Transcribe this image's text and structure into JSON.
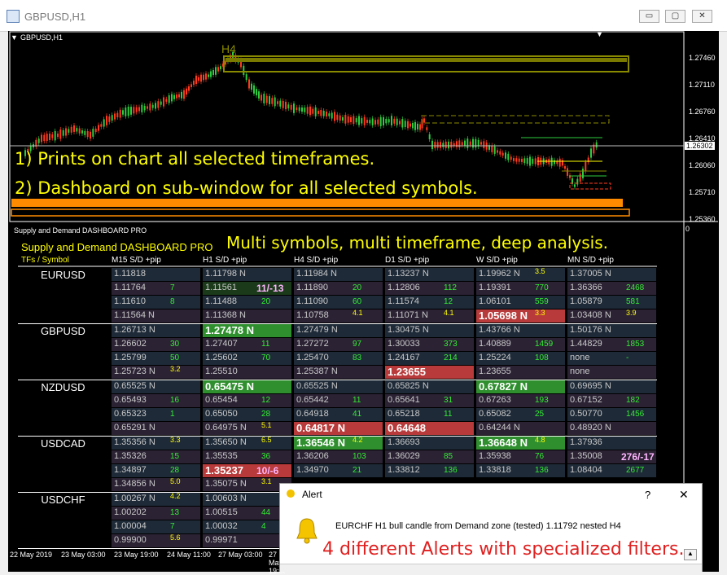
{
  "window": {
    "title": "GBPUSD,H1",
    "min": "▭",
    "max": "▢",
    "close": "✕"
  },
  "chart": {
    "symbol_label": "GBPUSD,H1",
    "tf_marker": "H4",
    "prices": [
      "1.27460",
      "1.27110",
      "1.26760",
      "1.26410",
      "1.26060",
      "1.25710",
      "1.25360"
    ],
    "current_price": "1.26302",
    "line1": "1) Prints on chart all selected timeframes.",
    "line2": "2) Dashboard on sub-window for all selected symbols.",
    "dates": [
      "22 May 2019",
      "23 May 03:00",
      "23 May 19:00",
      "24 May 11:00",
      "27 May 03:00",
      "27 May 19:00"
    ]
  },
  "subwindow": {
    "label": "Supply and Demand DASHBOARD PRO",
    "zero": "0",
    "headline": "Multi symbols, multi timeframe, deep analysis.",
    "dashboard_title": "Supply and Demand DASHBOARD PRO",
    "columns": [
      "TFs / Symbol",
      "M15 S/D +pip",
      "H1 S/D +pip",
      "H4 S/D +pip",
      "D1 S/D +pip",
      "W S/D +pip",
      "MN S/D +pip"
    ]
  },
  "dashboard": [
    {
      "symbol": "EURUSD",
      "rows": [
        [
          [
            "1.11818",
            ""
          ],
          [
            "1.11798 N",
            ""
          ],
          [
            "1.11984 N",
            ""
          ],
          [
            "1.13237 N",
            ""
          ],
          [
            "1.19962 N",
            "3.5"
          ],
          [
            "1.37005 N",
            ""
          ]
        ],
        [
          [
            "1.11764",
            "7"
          ],
          [
            "1.11561",
            "11/-13"
          ],
          [
            "1.11890",
            "20"
          ],
          [
            "1.12806",
            "112"
          ],
          [
            "1.19391",
            "770"
          ],
          [
            "1.36366",
            "2468"
          ]
        ],
        [
          [
            "1.11610",
            "8"
          ],
          [
            "1.11488",
            "20"
          ],
          [
            "1.11090",
            "60"
          ],
          [
            "1.11574",
            "12"
          ],
          [
            "1.06101",
            "559"
          ],
          [
            "1.05879",
            "581"
          ]
        ],
        [
          [
            "1.11564 N",
            ""
          ],
          [
            "1.11368 N",
            ""
          ],
          [
            "1.10758",
            "4.1"
          ],
          [
            "1.11071 N",
            "4.1"
          ],
          [
            "1.05698 N",
            "3.3"
          ],
          [
            "1.03408 N",
            "3.9"
          ]
        ]
      ]
    },
    {
      "symbol": "GBPUSD",
      "rows": [
        [
          [
            "1.26713 N",
            ""
          ],
          [
            "1.27478 N",
            ""
          ],
          [
            "1.27479 N",
            ""
          ],
          [
            "1.30475 N",
            ""
          ],
          [
            "1.43766 N",
            ""
          ],
          [
            "1.50176 N",
            ""
          ]
        ],
        [
          [
            "1.26602",
            "30"
          ],
          [
            "1.27407",
            "11"
          ],
          [
            "1.27272",
            "97"
          ],
          [
            "1.30033",
            "373"
          ],
          [
            "1.40889",
            "1459"
          ],
          [
            "1.44829",
            "1853"
          ]
        ],
        [
          [
            "1.25799",
            "50"
          ],
          [
            "1.25602",
            "70"
          ],
          [
            "1.25470",
            "83"
          ],
          [
            "1.24167",
            "214"
          ],
          [
            "1.25224",
            "108"
          ],
          [
            "none",
            "-"
          ]
        ],
        [
          [
            "1.25723 N",
            "3.2"
          ],
          [
            "1.25510",
            ""
          ],
          [
            "1.25387 N",
            ""
          ],
          [
            "1.23655",
            ""
          ],
          [
            "1.23655",
            ""
          ],
          [
            "none",
            ""
          ]
        ]
      ]
    },
    {
      "symbol": "NZDUSD",
      "rows": [
        [
          [
            "0.65525 N",
            ""
          ],
          [
            "0.65475 N",
            ""
          ],
          [
            "0.65525 N",
            ""
          ],
          [
            "0.65825 N",
            ""
          ],
          [
            "0.67827 N",
            ""
          ],
          [
            "0.69695 N",
            ""
          ]
        ],
        [
          [
            "0.65493",
            "16"
          ],
          [
            "0.65454",
            "12"
          ],
          [
            "0.65442",
            "11"
          ],
          [
            "0.65641",
            "31"
          ],
          [
            "0.67263",
            "193"
          ],
          [
            "0.67152",
            "182"
          ]
        ],
        [
          [
            "0.65323",
            "1"
          ],
          [
            "0.65050",
            "28"
          ],
          [
            "0.64918",
            "41"
          ],
          [
            "0.65218",
            "11"
          ],
          [
            "0.65082",
            "25"
          ],
          [
            "0.50770",
            "1456"
          ]
        ],
        [
          [
            "0.65291 N",
            ""
          ],
          [
            "0.64975 N",
            "5.1"
          ],
          [
            "0.64817 N",
            ""
          ],
          [
            "0.64648",
            ""
          ],
          [
            "0.64244 N",
            ""
          ],
          [
            "0.48920 N",
            ""
          ]
        ]
      ]
    },
    {
      "symbol": "USDCAD",
      "rows": [
        [
          [
            "1.35356 N",
            "3.3"
          ],
          [
            "1.35650 N",
            "6.5"
          ],
          [
            "1.36546 N",
            "4.2"
          ],
          [
            "1.36693",
            ""
          ],
          [
            "1.36648 N",
            "4.8"
          ],
          [
            "1.37936",
            ""
          ]
        ],
        [
          [
            "1.35326",
            "15"
          ],
          [
            "1.35535",
            "36"
          ],
          [
            "1.36206",
            "103"
          ],
          [
            "1.36029",
            "85"
          ],
          [
            "1.35938",
            "76"
          ],
          [
            "1.35008",
            "276/-17"
          ]
        ],
        [
          [
            "1.34897",
            "28"
          ],
          [
            "1.35237",
            "10/-6"
          ],
          [
            "1.34970",
            "21"
          ],
          [
            "1.33812",
            "136"
          ],
          [
            "1.33818",
            "136"
          ],
          [
            "1.08404",
            "2677"
          ]
        ],
        [
          [
            "1.34856 N",
            "5.0"
          ],
          [
            "1.35075 N",
            "3.1"
          ],
          [
            "",
            ""
          ],
          [
            "",
            ""
          ],
          [
            "",
            ""
          ],
          [
            "",
            ""
          ]
        ]
      ]
    },
    {
      "symbol": "USDCHF",
      "rows": [
        [
          [
            "1.00267 N",
            "4.2"
          ],
          [
            "1.00603 N",
            ""
          ],
          [
            "",
            ""
          ],
          [
            "",
            ""
          ],
          [
            "",
            ""
          ],
          [
            "",
            ""
          ]
        ],
        [
          [
            "1.00202",
            "13"
          ],
          [
            "1.00515",
            "44"
          ],
          [
            "",
            ""
          ],
          [
            "",
            ""
          ],
          [
            "",
            ""
          ],
          [
            "",
            ""
          ]
        ],
        [
          [
            "1.00004",
            "7"
          ],
          [
            "1.00032",
            "4"
          ],
          [
            "",
            ""
          ],
          [
            "",
            ""
          ],
          [
            "",
            ""
          ],
          [
            "",
            ""
          ]
        ],
        [
          [
            "0.99900",
            "5.6"
          ],
          [
            "0.99971",
            ""
          ],
          [
            "",
            ""
          ],
          [
            "",
            ""
          ],
          [
            "",
            ""
          ],
          [
            "",
            ""
          ]
        ]
      ]
    }
  ],
  "alert": {
    "title": "Alert",
    "help": "?",
    "close": "✕",
    "message": "EURCHF H1 bull candle from Demand zone (tested) 1.11792 nested H4",
    "promo": "4 different Alerts with specialized filters."
  },
  "colors": {
    "green_candle": "#2ecc40",
    "red_candle": "#ff3b1f",
    "zone_olive": "#7a7a00",
    "orange_zone": "#ff8c00",
    "yellow_text": "#ffff00",
    "green_cell": "#2f8f2f",
    "red_cell": "#b83a3a",
    "alert_red": "#e02020"
  }
}
